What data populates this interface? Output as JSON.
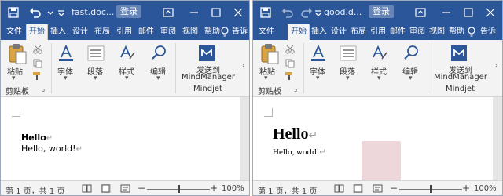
{
  "left": {
    "doc_title": "fast.doc...",
    "login_label": "登录",
    "tabs": [
      "文件",
      "开始",
      "插入",
      "设计",
      "布局",
      "引用",
      "邮件",
      "审阅",
      "视图",
      "帮助",
      "告诉"
    ],
    "active_tab": "开始",
    "ribbon": {
      "paste": "粘贴",
      "clipboard": "剪贴板",
      "font": "字体",
      "paragraph": "段落",
      "styles": "样式",
      "editing": "编辑",
      "send_to_line1": "发送到",
      "send_to_line2": "MindManager",
      "mindjet": "Mindjet"
    },
    "doc": {
      "line1": "Hello",
      "line2": "Hello, world!"
    },
    "status": {
      "page_info": "第 1 页，共 1 页",
      "zoom": "100%"
    }
  },
  "right": {
    "doc_title": "good.d...",
    "login_label": "登录",
    "tabs": [
      "文件",
      "开始",
      "插入",
      "设计",
      "布局",
      "引用",
      "邮件",
      "审阅",
      "视图",
      "帮助",
      "告诉"
    ],
    "active_tab": "开始",
    "ribbon": {
      "paste": "粘贴",
      "clipboard": "剪贴板",
      "font": "字体",
      "paragraph": "段落",
      "styles": "样式",
      "editing": "编辑",
      "send_to_line1": "发送到",
      "send_to_line2": "MindManager",
      "mindjet": "Mindjet"
    },
    "doc": {
      "line1": "Hello",
      "line2": "Hello, world!"
    },
    "status": {
      "page_info": "第 1 页，共 1 页",
      "zoom": "100%"
    }
  },
  "colors": {
    "title_bar": "#2b579a",
    "ribbon_bg": "#f3f3f3",
    "doc_bg": "#e6e6e6"
  }
}
